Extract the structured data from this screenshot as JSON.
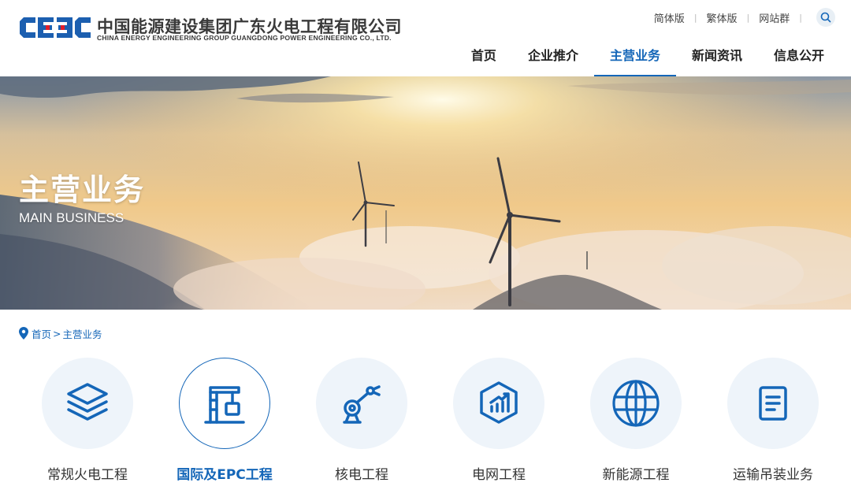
{
  "header": {
    "logo_cn": "中国能源建设集团广东火电工程有限公司",
    "logo_en": "CHINA ENERGY ENGINEERING GROUP GUANGDONG POWER ENGINEERING CO., LTD.",
    "logo_mark": "CEEC",
    "top_links": [
      "简体版",
      "繁体版",
      "网站群"
    ],
    "search_icon": "search-icon",
    "nav": [
      {
        "label": "首页",
        "active": false
      },
      {
        "label": "企业推介",
        "active": false
      },
      {
        "label": "主营业务",
        "active": true
      },
      {
        "label": "新闻资讯",
        "active": false
      },
      {
        "label": "信息公开",
        "active": false
      }
    ]
  },
  "banner": {
    "title": "主营业务",
    "subtitle": "MAIN BUSINESS"
  },
  "breadcrumb": {
    "icon": "location-pin-icon",
    "home": "首页",
    "separator": ">",
    "current": "主营业务"
  },
  "business": [
    {
      "label": "常规火电工程",
      "icon": "layers-icon",
      "active": false
    },
    {
      "label": "国际及EPC工程",
      "icon": "crane-icon",
      "active": true
    },
    {
      "label": "核电工程",
      "icon": "robotic-arm-icon",
      "active": false
    },
    {
      "label": "电网工程",
      "icon": "chart-hexagon-icon",
      "active": false
    },
    {
      "label": "新能源工程",
      "icon": "globe-icon",
      "active": false
    },
    {
      "label": "运输吊装业务",
      "icon": "document-icon",
      "active": false
    }
  ],
  "colors": {
    "accent": "#1466b8",
    "logo_blue": "#1c5fb0",
    "icon_circle": "#eef4fa"
  }
}
